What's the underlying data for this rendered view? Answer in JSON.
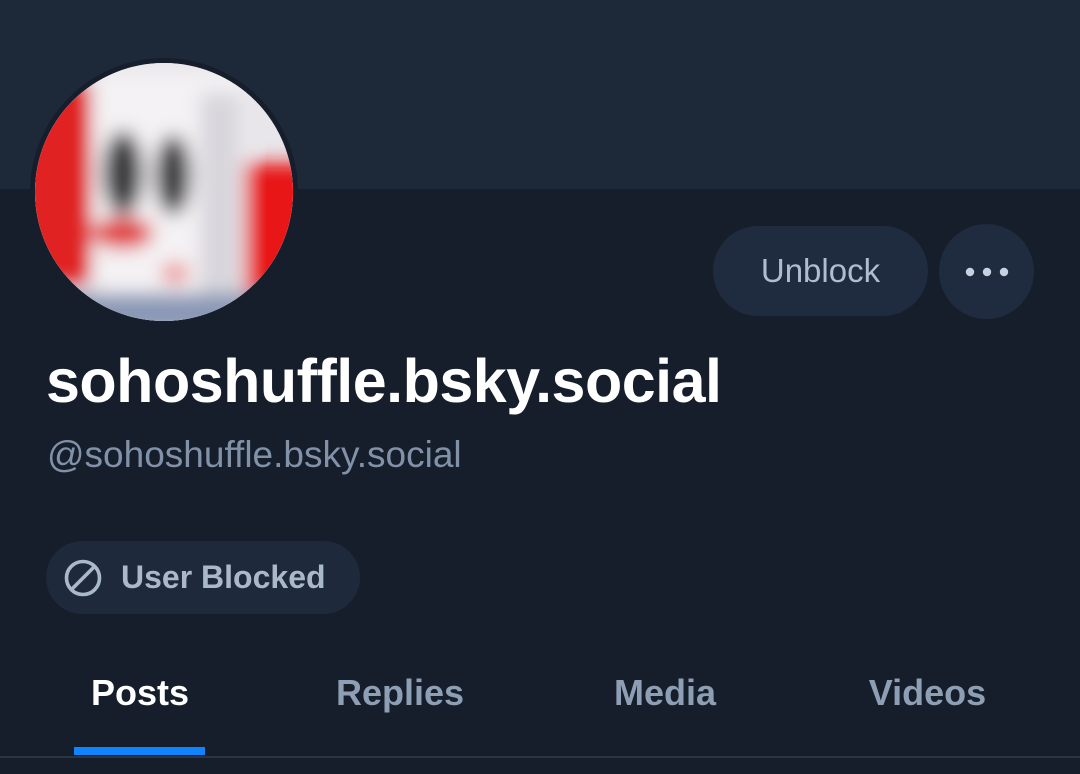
{
  "profile": {
    "display_name": "sohoshuffle.bsky.social",
    "handle": "@sohoshuffle.bsky.social",
    "avatar_icon": "blurred-avatar-image"
  },
  "actions": {
    "unblock_label": "Unblock",
    "more_icon": "ellipsis-icon"
  },
  "status": {
    "blocked_label": "User Blocked",
    "blocked_icon": "ban-icon"
  },
  "tabs": [
    {
      "label": "Posts",
      "active": true
    },
    {
      "label": "Replies",
      "active": false
    },
    {
      "label": "Media",
      "active": false
    },
    {
      "label": "Videos",
      "active": false
    }
  ],
  "colors": {
    "background": "#161e2b",
    "banner": "#1d2839",
    "accent": "#1083fe"
  }
}
